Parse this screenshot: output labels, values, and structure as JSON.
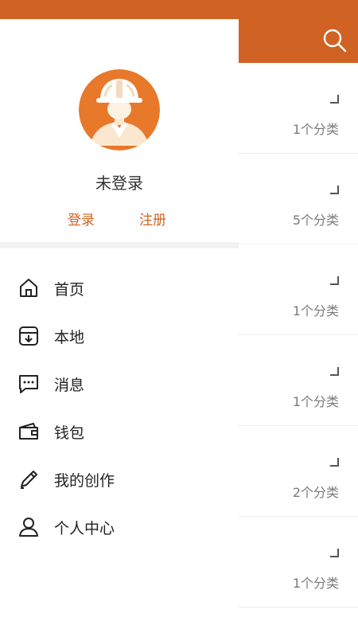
{
  "colors": {
    "accent": "#d06224",
    "avatar": "#e8782a"
  },
  "header": {
    "search_icon": "search-icon"
  },
  "list": {
    "items": [
      {
        "count": "1个分类"
      },
      {
        "count": "5个分类"
      },
      {
        "count": "1个分类"
      },
      {
        "count": "1个分类"
      },
      {
        "count": "2个分类"
      },
      {
        "count": "1个分类"
      }
    ]
  },
  "drawer": {
    "avatar_icon": "worker-helmet-avatar",
    "username": "未登录",
    "login_label": "登录",
    "register_label": "注册",
    "menu": [
      {
        "label": "首页",
        "icon": "home-icon"
      },
      {
        "label": "本地",
        "icon": "local-box-icon"
      },
      {
        "label": "消息",
        "icon": "message-icon"
      },
      {
        "label": "钱包",
        "icon": "wallet-icon"
      },
      {
        "label": "我的创作",
        "icon": "pencil-icon"
      },
      {
        "label": "个人中心",
        "icon": "user-icon"
      }
    ]
  }
}
